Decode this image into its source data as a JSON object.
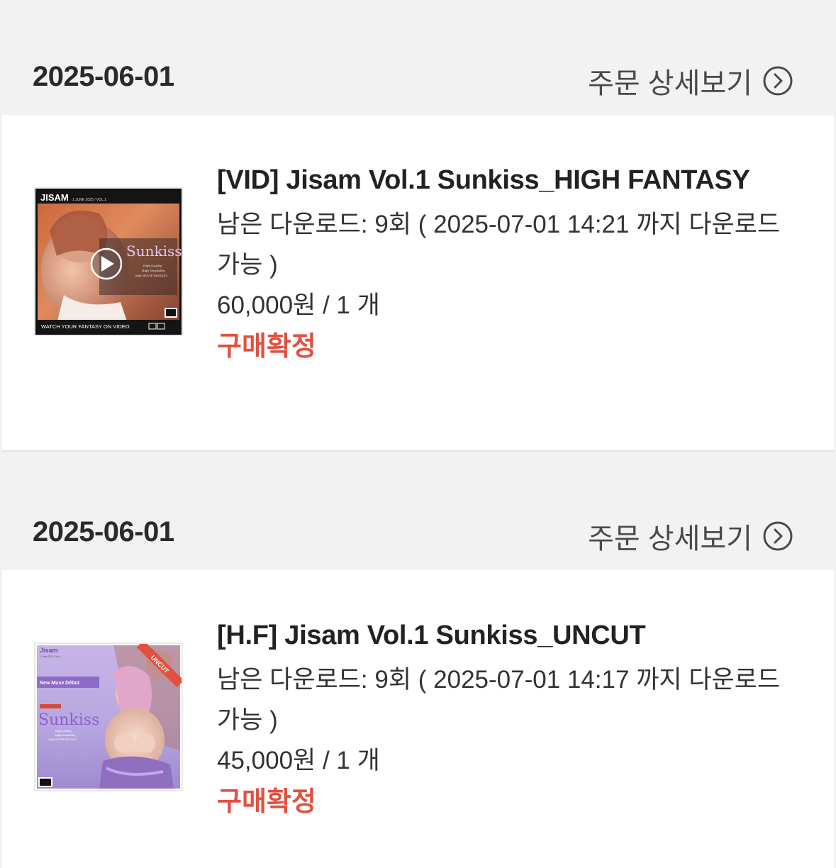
{
  "orders": [
    {
      "date": "2025-06-01",
      "detail_label": "주문 상세보기",
      "detail_icon": "chevron-right-circle-icon",
      "item": {
        "title": "[VID] Jisam Vol.1 Sunkiss_HIGH FANTASY",
        "download_line1": "남은 다운로드: 9회 ( 2025-07-01 14:21 까지 다운로드",
        "download_line2": "가능 )",
        "price": "60,000원 / 1 개",
        "status": "구매확정",
        "thumb": {
          "brand": "JISAM",
          "issue": "1 JUNE 2025 / VOL.1",
          "name": "Sunkiss",
          "tagline": "High Quality, High Sensibility, Only MOVIE FANTASY.",
          "footer": "WATCH YOUR FANTASY ON VIDEO",
          "play_icon": "play-circle-icon"
        }
      }
    },
    {
      "date": "2025-06-01",
      "detail_label": "주문 상세보기",
      "detail_icon": "chevron-right-circle-icon",
      "item": {
        "title": "[H.F] Jisam Vol.1 Sunkiss_UNCUT",
        "download_line1": "남은 다운로드: 9회 ( 2025-07-01 14:17 까지 다운로드",
        "download_line2": "가능 )",
        "price": "45,000원 / 1 개",
        "status": "구매확정",
        "thumb": {
          "brand": "Jisam",
          "issue": "1 June 2025 / Vol.1",
          "ribbon": "UNCUT",
          "banner": "New Muse Début",
          "name": "Sunkiss",
          "tagline": "High Quality, High Sensibility, Only MOVIE FANTASY"
        }
      }
    }
  ],
  "colors": {
    "background": "#f2f2f3",
    "card": "#ffffff",
    "status": "#e2503f",
    "text": "#222222",
    "muted": "#4a4a4a"
  }
}
